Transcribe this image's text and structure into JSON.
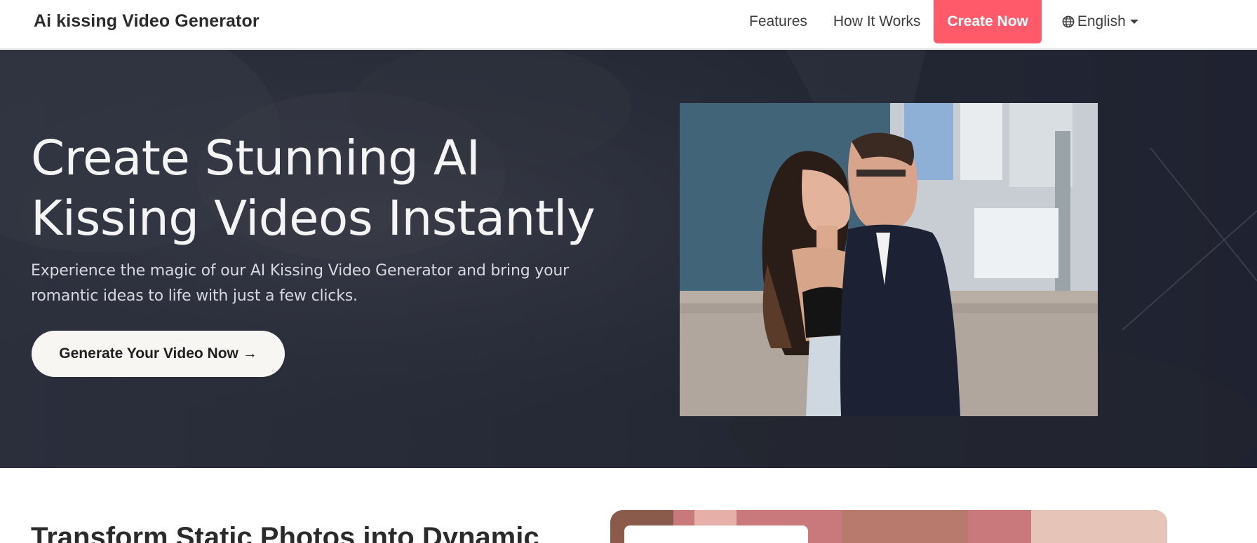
{
  "navbar": {
    "brand": "Ai kissing Video Generator",
    "links": [
      "Features",
      "How It Works"
    ],
    "cta_label": "Create Now",
    "language_label": "English",
    "language_icon": "globe-icon",
    "cta_color": "#ff5a6a"
  },
  "hero": {
    "title_line1": "Create Stunning AI",
    "title_line2": "Kissing Videos Instantly",
    "subtitle_line1": "Experience the magic of our AI Kissing Video Generator and bring your",
    "subtitle_line2": "romantic ideas to life with just a few clicks.",
    "button_label": "Generate Your Video Now →"
  },
  "next_section": {
    "title": "Transform Static Photos into Dynamic"
  }
}
